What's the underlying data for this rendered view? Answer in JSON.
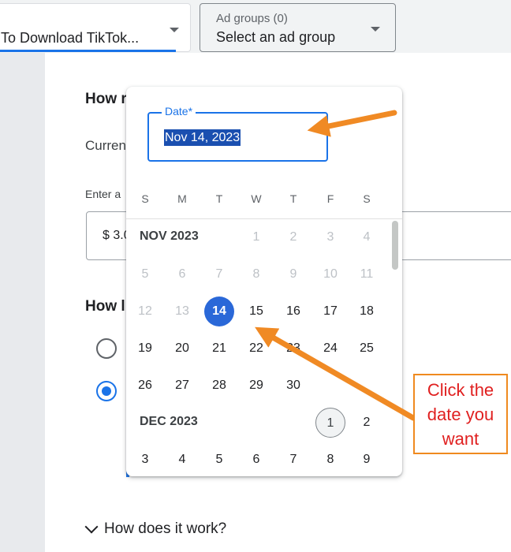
{
  "top_bar": {
    "campaign_value": "To Download TikTok...",
    "ad_group_label": "Ad groups (0)",
    "ad_group_value": "Select an ad group"
  },
  "budget_panel": {
    "question_1_partial": "How r",
    "current_partial": "Curren",
    "enter_partial": "Enter a",
    "amount_partial": "$ 3.0",
    "question_2_partial": "How l",
    "how_it_works": "How does it work?"
  },
  "date_picker": {
    "field_label": "Date*",
    "field_value": "Nov 14, 2023",
    "weekdays": [
      "S",
      "M",
      "T",
      "W",
      "T",
      "F",
      "S"
    ],
    "months": [
      {
        "label": "NOV 2023",
        "rows": [
          [
            "",
            "",
            "",
            "1",
            "2",
            "3",
            "4"
          ],
          [
            "5",
            "6",
            "7",
            "8",
            "9",
            "10",
            "11"
          ],
          [
            "12",
            "13",
            "14",
            "15",
            "16",
            "17",
            "18"
          ],
          [
            "19",
            "20",
            "21",
            "22",
            "23",
            "24",
            "25"
          ],
          [
            "26",
            "27",
            "28",
            "29",
            "30",
            "",
            ""
          ]
        ]
      },
      {
        "label": "DEC 2023",
        "rows": [
          [
            "",
            "",
            "",
            "",
            "",
            "1",
            "2"
          ],
          [
            "3",
            "4",
            "5",
            "6",
            "7",
            "8",
            "9"
          ]
        ]
      }
    ],
    "selected": "Nov 14",
    "today": "Dec 1"
  },
  "annotation": {
    "callout_line1": "Click the",
    "callout_line2": "date you",
    "callout_line3": "want"
  },
  "colors": {
    "accent_blue": "#1a73e8",
    "selected_day": "#2a68d8",
    "arrow_orange": "#f08a24",
    "callout_text": "#e02020"
  }
}
